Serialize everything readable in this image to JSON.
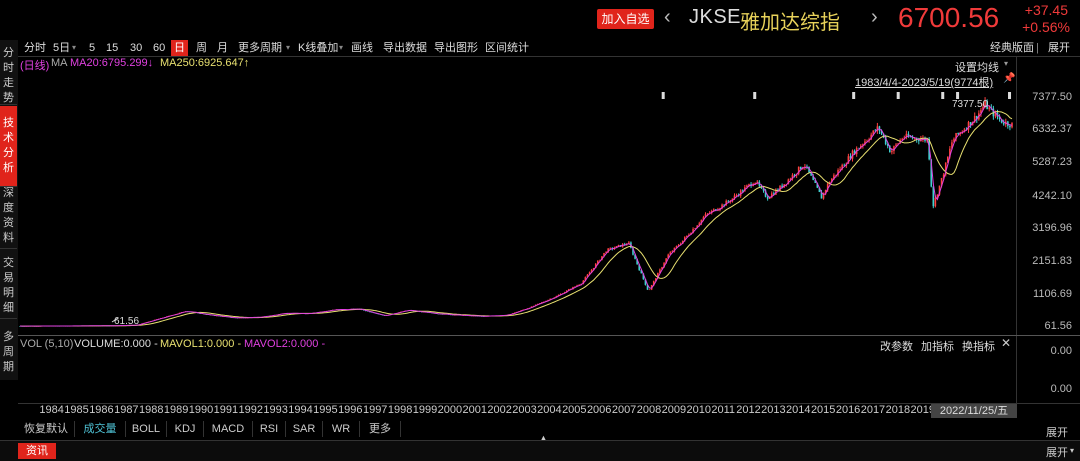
{
  "header": {
    "add_label": "加入自选",
    "prev_arrow": "‹",
    "next_arrow": "›",
    "code": "JKSE",
    "name": "雅加达综指",
    "price": "6700.56",
    "change_abs": "+37.45",
    "change_pct": "+0.56%"
  },
  "toolbar": {
    "items": [
      "分时",
      "5日",
      "5",
      "15",
      "30",
      "60",
      "日",
      "周",
      "月",
      "更多周期",
      "K线叠加",
      "画线",
      "导出数据",
      "导出图形",
      "区间统计"
    ],
    "active": "日",
    "more_arrow": "▾",
    "right_items": [
      "经典版面",
      "展开"
    ]
  },
  "sidebar": {
    "items": [
      "分时走势",
      "技术分析",
      "深度资料",
      "交易明细",
      "多周期"
    ],
    "active": "技术分析"
  },
  "chart_info": {
    "label_day": "(日线)",
    "ma_label": "MA",
    "ma20": "MA20:6795.299↓",
    "ma250": "MA250:6925.647↑",
    "settings": "设置均线",
    "range": "1983/4/4-2023/5/19(9774根)",
    "max_marker": "7377.50",
    "min_marker": "61.56",
    "colors": {
      "ma20": "#e040e0",
      "ma250": "#e8e070",
      "candle_up": "#ff4040",
      "candle_down": "#40d0d0"
    }
  },
  "y_axis": [
    "7377.50",
    "6332.37",
    "5287.23",
    "4242.10",
    "3196.96",
    "2151.83",
    "1106.69",
    "61.56"
  ],
  "volume": {
    "label": "VOL (5,10)",
    "volume": "VOLUME:0.000 -",
    "mavol1": "MAVOL1:0.000 -",
    "mavol2": "MAVOL2:0.000 -",
    "actions": [
      "改参数",
      "加指标",
      "换指标"
    ],
    "close": "✕",
    "axis": [
      "0.00",
      "0.00"
    ]
  },
  "x_axis": {
    "years": [
      "1984",
      "1985",
      "1986",
      "1987",
      "1988",
      "1989",
      "1990",
      "1991",
      "1992",
      "1993",
      "1994",
      "1995",
      "1996",
      "1997",
      "1998",
      "1999",
      "2000",
      "2001",
      "2002",
      "2003",
      "2004",
      "2005",
      "2006",
      "2007",
      "2008",
      "2009",
      "2010",
      "2011",
      "2012",
      "2013",
      "2014",
      "2015",
      "2016",
      "2017",
      "2018",
      "2019"
    ],
    "current_date": "2022/11/25/五"
  },
  "bottom_tabs": {
    "items": [
      "恢复默认",
      "成交量",
      "BOLL",
      "KDJ",
      "MACD",
      "RSI",
      "SAR",
      "WR",
      "更多"
    ],
    "active": "成交量",
    "collapse_arrow": "▲",
    "expand": "展开"
  },
  "footer": {
    "news": "资讯",
    "expand": "展开",
    "expand_arrow": "▾"
  },
  "chart_data": {
    "type": "candlestick",
    "series_points": [
      [
        1983.3,
        60
      ],
      [
        1985,
        62
      ],
      [
        1987,
        70
      ],
      [
        1988,
        90
      ],
      [
        1989,
        320
      ],
      [
        1990,
        550
      ],
      [
        1991,
        420
      ],
      [
        1992,
        330
      ],
      [
        1993,
        350
      ],
      [
        1994,
        480
      ],
      [
        1995,
        470
      ],
      [
        1996,
        600
      ],
      [
        1997,
        620
      ],
      [
        1998,
        400
      ],
      [
        1999,
        580
      ],
      [
        2000,
        480
      ],
      [
        2001,
        420
      ],
      [
        2002,
        380
      ],
      [
        2003,
        420
      ],
      [
        2004,
        700
      ],
      [
        2005,
        1050
      ],
      [
        2006,
        1480
      ],
      [
        2007,
        2550
      ],
      [
        2007.9,
        2800
      ],
      [
        2008.7,
        1200
      ],
      [
        2009.5,
        2400
      ],
      [
        2010,
        2800
      ],
      [
        2011,
        3700
      ],
      [
        2012,
        4200
      ],
      [
        2013,
        4850
      ],
      [
        2013.5,
        4300
      ],
      [
        2014,
        4600
      ],
      [
        2015,
        5400
      ],
      [
        2015.7,
        4300
      ],
      [
        2016,
        4800
      ],
      [
        2017,
        5800
      ],
      [
        2018,
        6600
      ],
      [
        2018.5,
        5800
      ],
      [
        2019,
        6300
      ],
      [
        2020,
        6200
      ],
      [
        2020.2,
        4000
      ],
      [
        2020.6,
        5000
      ],
      [
        2021,
        6200
      ],
      [
        2022,
        7000
      ],
      [
        2022.3,
        7377.5
      ],
      [
        2022.6,
        7100
      ],
      [
        2023,
        6800
      ],
      [
        2023.38,
        6700.56
      ]
    ],
    "ylim": [
      61.56,
      7377.5
    ],
    "xlim": [
      1983.3,
      2023.4
    ]
  }
}
